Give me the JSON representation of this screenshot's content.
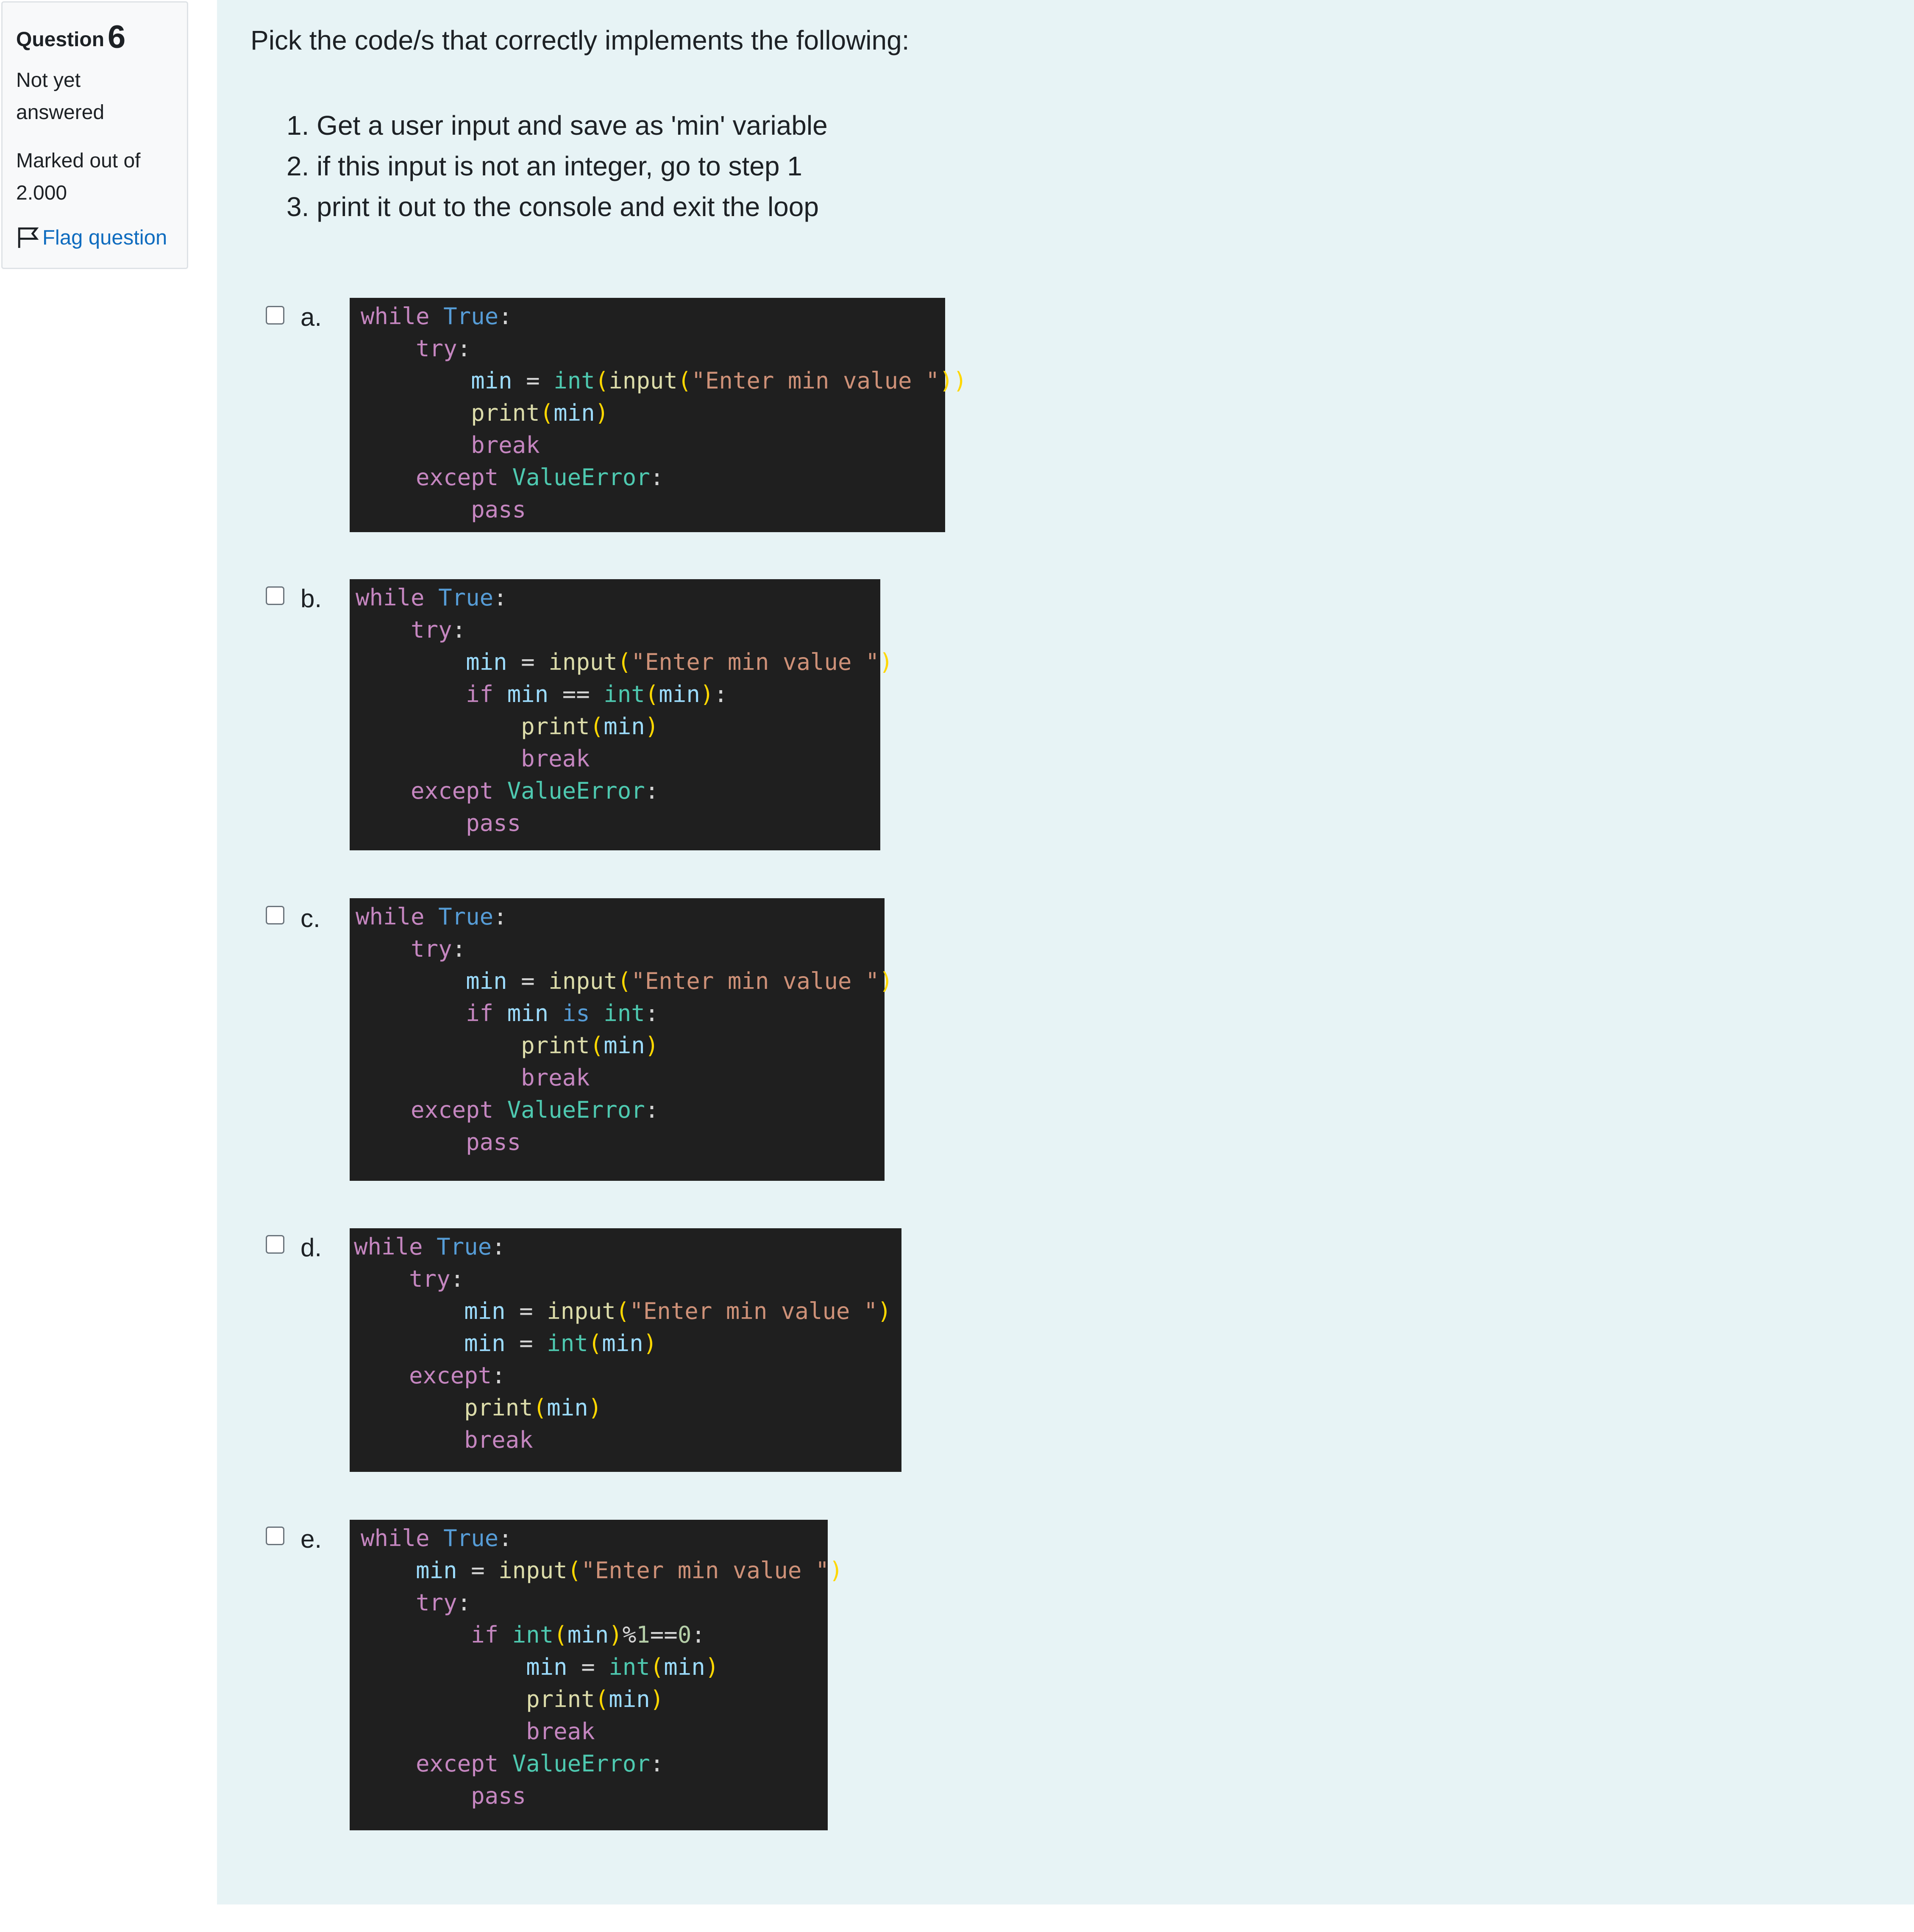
{
  "info": {
    "question_word": "Question",
    "question_number": "6",
    "state": "Not yet answered",
    "grade": "Marked out of 2.000",
    "flag_label": "Flag question"
  },
  "question": {
    "text": "Pick the code/s that correctly implements the following:",
    "steps": [
      "1. Get a user input and save as 'min' variable",
      "2. if this input is not an integer, go to step 1",
      "3. print it out to the console and exit the loop"
    ]
  },
  "options": [
    {
      "letter": "a.",
      "checked": false,
      "code": [
        "while True:",
        "    try:",
        "        min = int(input(\"Enter min value \"))",
        "        print(min)",
        "        break",
        "    except ValueError:",
        "        pass"
      ]
    },
    {
      "letter": "b.",
      "checked": false,
      "code": [
        "while True:",
        "    try:",
        "        min = input(\"Enter min value \")",
        "        if min == int(min):",
        "            print(min)",
        "            break",
        "    except ValueError:",
        "        pass"
      ]
    },
    {
      "letter": "c.",
      "checked": false,
      "code": [
        "while True:",
        "    try:",
        "        min = input(\"Enter min value \")",
        "        if min is int:",
        "            print(min)",
        "            break",
        "    except ValueError:",
        "        pass"
      ]
    },
    {
      "letter": "d.",
      "checked": false,
      "code": [
        "while True:",
        "    try:",
        "        min = input(\"Enter min value \")",
        "        min = int(min)",
        "    except:",
        "        print(min)",
        "        break"
      ]
    },
    {
      "letter": "e.",
      "checked": false,
      "code": [
        "while True:",
        "    min = input(\"Enter min value \")",
        "    try:",
        "        if int(min)%1==0:",
        "            min = int(min)",
        "            print(min)",
        "            break",
        "    except ValueError:",
        "        pass"
      ]
    }
  ],
  "colors": {
    "code_background": "#1f1f1f",
    "keyword": "#c586c0",
    "constant": "#569cd6",
    "variable": "#9cdcfe",
    "function": "#dcdcaa",
    "type": "#4ec9b0",
    "string": "#ce9178",
    "bracket": "#ffd700",
    "link": "#0f6cbf",
    "content_background": "#e7f3f5"
  }
}
